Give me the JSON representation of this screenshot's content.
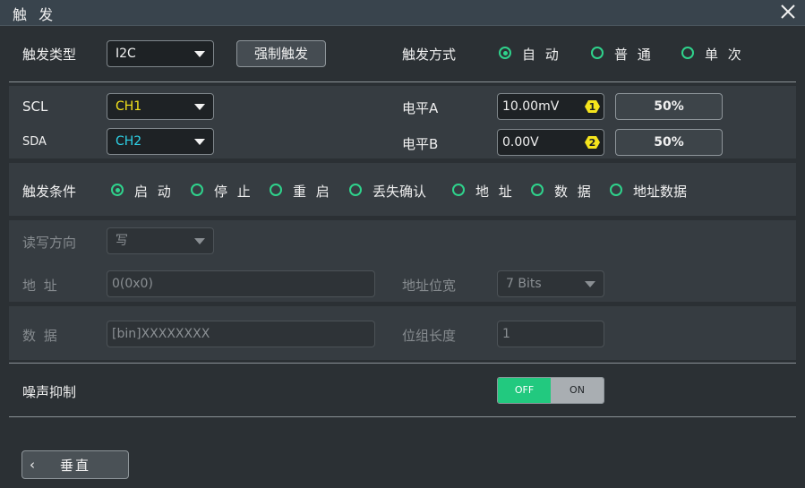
{
  "window": {
    "title": "触 发",
    "close_icon": "close-icon"
  },
  "trigger_type": {
    "label": "触发类型",
    "value": "I2C"
  },
  "force_trigger": {
    "label": "强制触发"
  },
  "trigger_mode": {
    "label": "触发方式",
    "options": [
      {
        "label": "自 动",
        "selected": true
      },
      {
        "label": "普 通",
        "selected": false
      },
      {
        "label": "单 次",
        "selected": false
      }
    ]
  },
  "source": {
    "scl_label": "SCL",
    "scl_value": "CH1",
    "scl_color": "#f5e41c",
    "sda_label": "SDA",
    "sda_value": "CH2",
    "sda_color": "#2ed3e8"
  },
  "level": {
    "a_label": "电平A",
    "a_value": "10.00mV",
    "a_badge": "1",
    "a_pct": "50%",
    "b_label": "电平B",
    "b_value": "0.00V",
    "b_badge": "2",
    "b_pct": "50%"
  },
  "trigger_condition": {
    "label": "触发条件",
    "options": [
      {
        "label": "启 动",
        "selected": true
      },
      {
        "label": "停 止",
        "selected": false
      },
      {
        "label": "重 启",
        "selected": false
      },
      {
        "label": "丢失确认",
        "selected": false
      },
      {
        "label": "地 址",
        "selected": false
      },
      {
        "label": "数 据",
        "selected": false
      },
      {
        "label": "地址数据",
        "selected": false
      }
    ]
  },
  "rw": {
    "label": "读写方向",
    "value": "写"
  },
  "address": {
    "label": "地 址",
    "value": "0(0x0)"
  },
  "address_width": {
    "label": "地址位宽",
    "value": "7 Bits"
  },
  "data_row": {
    "label": "数 据",
    "value": "[bin]XXXXXXXX"
  },
  "byte_length": {
    "label": "位组长度",
    "value": "1"
  },
  "noise": {
    "label": "噪声抑制",
    "off": "OFF",
    "on": "ON",
    "state": "OFF"
  },
  "vertical_button": {
    "label": "垂直"
  },
  "colors": {
    "accent": "#2fd38c",
    "toggle_off": "#22c97f",
    "badge": "#f5e41c"
  }
}
